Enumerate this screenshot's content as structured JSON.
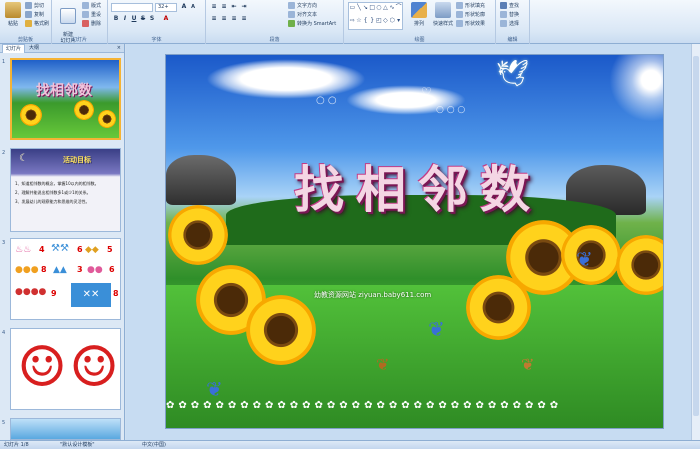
{
  "ribbon": {
    "clipboard": {
      "label": "剪贴板",
      "paste": "粘贴",
      "cut": "剪切",
      "copy": "复制",
      "format_painter": "格式刷"
    },
    "slides": {
      "label": "幻灯片",
      "new_slide": "新建\n幻灯片",
      "layout": "版式",
      "reset": "重设",
      "delete": "删除"
    },
    "font": {
      "label": "字体",
      "font_name": "",
      "font_size": "32+"
    },
    "paragraph": {
      "label": "段落",
      "text_direction": "文字方向",
      "align_text": "对齐文本",
      "smartart": "转换为 SmartArt"
    },
    "drawing": {
      "label": "绘图",
      "arrange": "排列",
      "quick_styles": "快速样式",
      "shape_fill": "形状填充",
      "shape_outline": "形状轮廓",
      "shape_effects": "形状效果"
    },
    "editing": {
      "label": "编辑",
      "find": "查找",
      "replace": "替换",
      "select": "选择"
    }
  },
  "pane": {
    "tab_slides": "幻灯片",
    "tab_outline": "大纲",
    "close": "×",
    "slide_numbers": [
      "1",
      "2",
      "3",
      "4",
      "5"
    ],
    "thumb2_title": "活动目标",
    "thumb2_lines": [
      "1、知道相邻数的概念，掌握10以内的相邻数。",
      "2、理解并能说出相邻数多1或少1的关系。",
      "3、发展幼儿的观察能力和思维的灵活性。"
    ],
    "thumb3_numbers": [
      "4",
      "6",
      "5",
      "8",
      "3",
      "6",
      "9",
      "8"
    ]
  },
  "slide": {
    "title_chars": [
      "找",
      "相",
      "邻",
      "数"
    ],
    "watermark": "幼教资源网站 ziyuan.baby611.com"
  },
  "status": {
    "slide_count": "幻灯片 1/8",
    "theme": "\"默认设计模板\"",
    "language": "中文(中国)"
  },
  "colors": {
    "ribbon_bg": "#dbe8f6",
    "pane_bg": "#dce8f5",
    "edit_bg": "#c7dcf2",
    "selected_thumb_border": "#f5b335",
    "title_outline": "#7a1654"
  }
}
